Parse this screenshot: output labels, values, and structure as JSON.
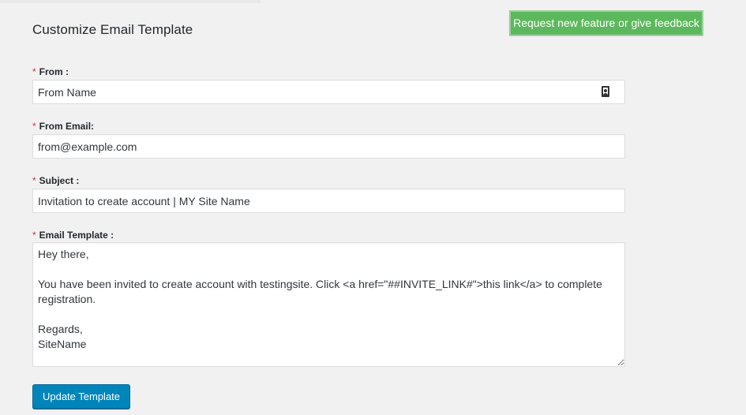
{
  "page": {
    "title": "Customize Email Template",
    "feedback_button": "Request new feature or give feedback"
  },
  "form": {
    "required_marker": "*",
    "from": {
      "label": "From :",
      "value": "From Name",
      "icon": "contact-card-icon"
    },
    "from_email": {
      "label": "From Email:",
      "value": "from@example.com"
    },
    "subject": {
      "label": "Subject :",
      "value": "Invitation to create account | MY Site Name"
    },
    "email_template": {
      "label": "Email Template :",
      "value": "Hey there,\n\nYou have been invited to create account with testingsite. Click <a href=\"##INVITE_LINK#\">this link</a> to complete registration.\n\nRegards,\nSiteName"
    },
    "submit_label": "Update Template"
  },
  "colors": {
    "background": "#f1f1f1",
    "feedback_green": "#5cb85c",
    "primary_blue": "#0085ba",
    "required_red": "#dc3232"
  }
}
